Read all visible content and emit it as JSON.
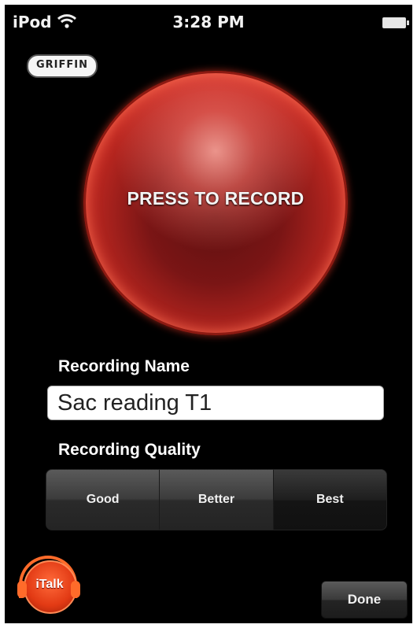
{
  "status_bar": {
    "carrier": "iPod",
    "time": "3:28 PM",
    "wifi_icon": "wifi-icon",
    "battery_icon": "battery-icon"
  },
  "brand": {
    "logo_text": "GRIFFIN"
  },
  "record": {
    "label": "PRESS TO RECORD",
    "color": "#d8322a"
  },
  "recording_name": {
    "label": "Recording Name",
    "value": "Sac reading T1"
  },
  "recording_quality": {
    "label": "Recording Quality",
    "options": [
      "Good",
      "Better",
      "Best"
    ],
    "selected": "Best"
  },
  "app_logo": {
    "text": "iTalk",
    "color": "#ff5a1e"
  },
  "done_label": "Done"
}
